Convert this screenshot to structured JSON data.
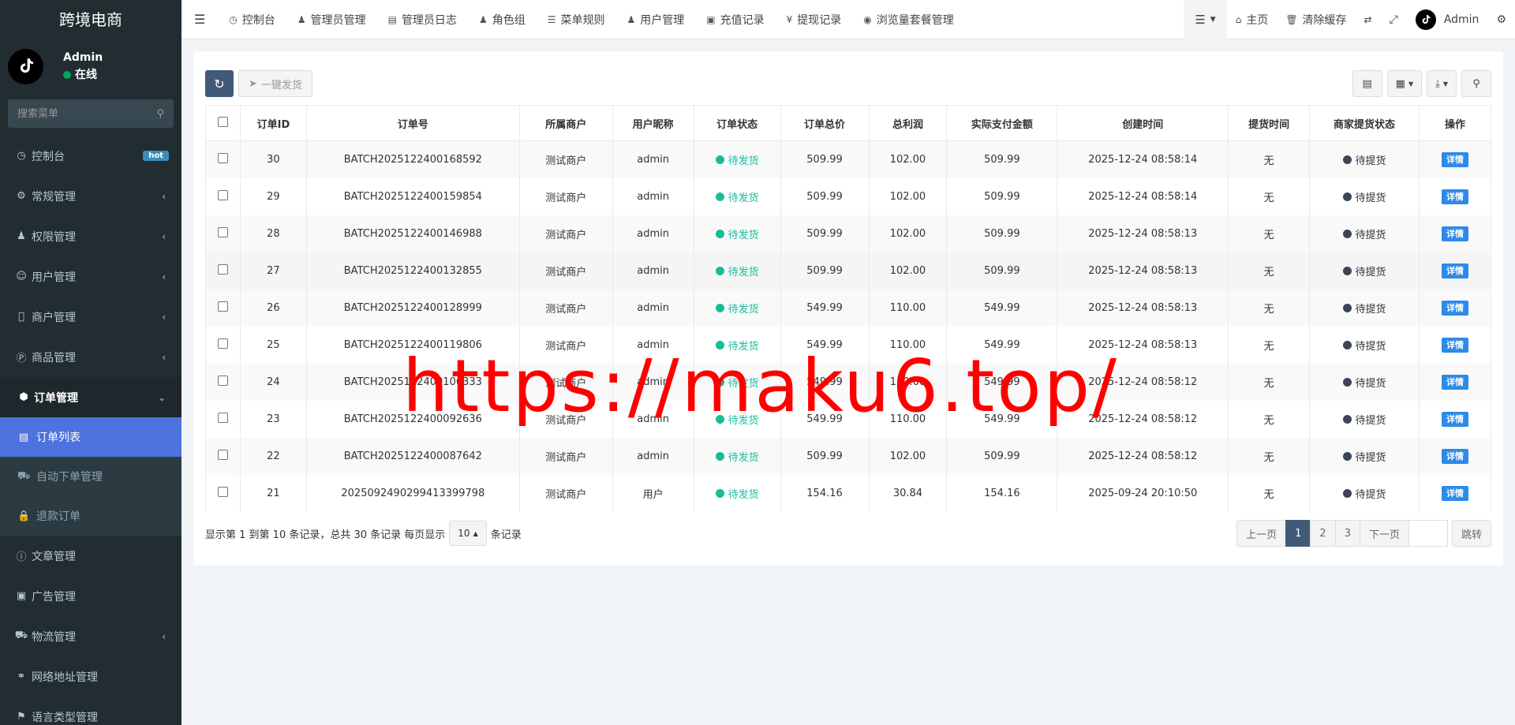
{
  "app": {
    "title": "跨境电商"
  },
  "user": {
    "name": "Admin",
    "status": "在线"
  },
  "sidebar": {
    "search_placeholder": "搜索菜单",
    "items": [
      {
        "label": "控制台",
        "badge": "hot"
      },
      {
        "label": "常规管理"
      },
      {
        "label": "权限管理"
      },
      {
        "label": "用户管理"
      },
      {
        "label": "商户管理"
      },
      {
        "label": "商品管理"
      },
      {
        "label": "订单管理"
      },
      {
        "label": "文章管理"
      },
      {
        "label": "广告管理"
      },
      {
        "label": "物流管理"
      },
      {
        "label": "网络地址管理"
      },
      {
        "label": "语言类型管理"
      }
    ],
    "order_sub": [
      {
        "label": "订单列表"
      },
      {
        "label": "自动下单管理"
      },
      {
        "label": "退款订单"
      }
    ]
  },
  "topbar": {
    "tabs": [
      "控制台",
      "管理员管理",
      "管理员日志",
      "角色组",
      "菜单规则",
      "用户管理",
      "充值记录",
      "提现记录",
      "浏览量套餐管理"
    ],
    "home": "主页",
    "clear_cache": "清除缓存",
    "admin": "Admin"
  },
  "toolbar": {
    "ship_label": "一键发货"
  },
  "table": {
    "headers": [
      "订单ID",
      "订单号",
      "所属商户",
      "用户昵称",
      "订单状态",
      "订单总价",
      "总利润",
      "实际支付金额",
      "创建时间",
      "提货时间",
      "商家提货状态",
      "操作"
    ],
    "rows": [
      {
        "id": "30",
        "order_no": "BATCH2025122400168592",
        "merchant": "测试商户",
        "nickname": "admin",
        "status": "待发货",
        "total": "509.99",
        "profit": "102.00",
        "paid": "509.99",
        "created": "2025-12-24 08:58:14",
        "pickup_time": "无",
        "pickup_status": "待提货",
        "action": "详情"
      },
      {
        "id": "29",
        "order_no": "BATCH2025122400159854",
        "merchant": "测试商户",
        "nickname": "admin",
        "status": "待发货",
        "total": "509.99",
        "profit": "102.00",
        "paid": "509.99",
        "created": "2025-12-24 08:58:14",
        "pickup_time": "无",
        "pickup_status": "待提货",
        "action": "详情"
      },
      {
        "id": "28",
        "order_no": "BATCH2025122400146988",
        "merchant": "测试商户",
        "nickname": "admin",
        "status": "待发货",
        "total": "509.99",
        "profit": "102.00",
        "paid": "509.99",
        "created": "2025-12-24 08:58:13",
        "pickup_time": "无",
        "pickup_status": "待提货",
        "action": "详情"
      },
      {
        "id": "27",
        "order_no": "BATCH2025122400132855",
        "merchant": "测试商户",
        "nickname": "admin",
        "status": "待发货",
        "total": "509.99",
        "profit": "102.00",
        "paid": "509.99",
        "created": "2025-12-24 08:58:13",
        "pickup_time": "无",
        "pickup_status": "待提货",
        "action": "详情"
      },
      {
        "id": "26",
        "order_no": "BATCH2025122400128999",
        "merchant": "测试商户",
        "nickname": "admin",
        "status": "待发货",
        "total": "549.99",
        "profit": "110.00",
        "paid": "549.99",
        "created": "2025-12-24 08:58:13",
        "pickup_time": "无",
        "pickup_status": "待提货",
        "action": "详情"
      },
      {
        "id": "25",
        "order_no": "BATCH2025122400119806",
        "merchant": "测试商户",
        "nickname": "admin",
        "status": "待发货",
        "total": "549.99",
        "profit": "110.00",
        "paid": "549.99",
        "created": "2025-12-24 08:58:13",
        "pickup_time": "无",
        "pickup_status": "待提货",
        "action": "详情"
      },
      {
        "id": "24",
        "order_no": "BATCH2025122400106333",
        "merchant": "测试商户",
        "nickname": "admin",
        "status": "待发货",
        "total": "549.99",
        "profit": "110.00",
        "paid": "549.99",
        "created": "2025-12-24 08:58:12",
        "pickup_time": "无",
        "pickup_status": "待提货",
        "action": "详情"
      },
      {
        "id": "23",
        "order_no": "BATCH2025122400092636",
        "merchant": "测试商户",
        "nickname": "admin",
        "status": "待发货",
        "total": "549.99",
        "profit": "110.00",
        "paid": "549.99",
        "created": "2025-12-24 08:58:12",
        "pickup_time": "无",
        "pickup_status": "待提货",
        "action": "详情"
      },
      {
        "id": "22",
        "order_no": "BATCH2025122400087642",
        "merchant": "测试商户",
        "nickname": "admin",
        "status": "待发货",
        "total": "509.99",
        "profit": "102.00",
        "paid": "509.99",
        "created": "2025-12-24 08:58:12",
        "pickup_time": "无",
        "pickup_status": "待提货",
        "action": "详情"
      },
      {
        "id": "21",
        "order_no": "2025092490299413399798",
        "merchant": "测试商户",
        "nickname": "用户",
        "status": "待发货",
        "total": "154.16",
        "profit": "30.84",
        "paid": "154.16",
        "created": "2025-09-24 20:10:50",
        "pickup_time": "无",
        "pickup_status": "待提货",
        "action": "详情"
      }
    ]
  },
  "footer": {
    "summary": "显示第 1 到第 10 条记录，总共 30 条记录 每页显示",
    "page_size": "10",
    "suffix": "条记录",
    "prev": "上一页",
    "pages": [
      "1",
      "2",
      "3"
    ],
    "next": "下一页",
    "jump": "跳转"
  },
  "watermark": "https://maku6.top/",
  "colors": {
    "sidebar_bg": "#222d32",
    "active_sub": "#4e73df",
    "status_green": "#18bc9c",
    "detail_blue": "#2c8ae8",
    "watermark_red": "#ff0000"
  }
}
